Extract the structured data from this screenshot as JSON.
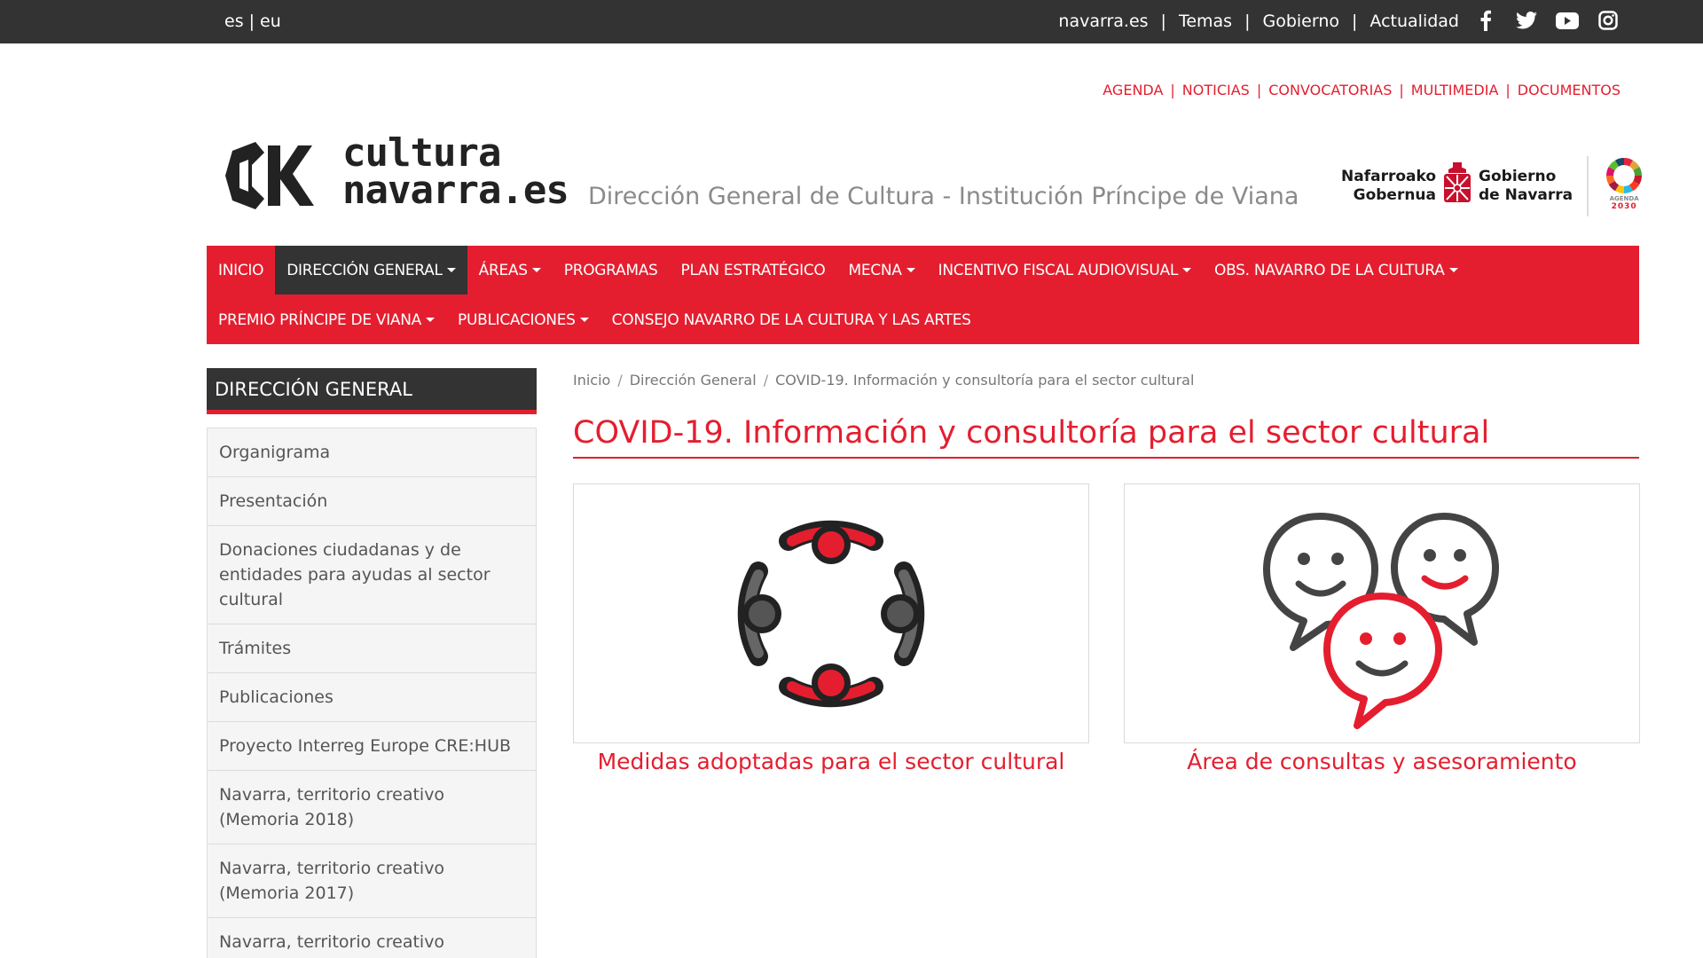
{
  "topbar": {
    "languages": [
      "es",
      "eu"
    ],
    "separator": "|",
    "links": [
      "navarra.es",
      "Temas",
      "Gobierno",
      "Actualidad"
    ],
    "social_icons": [
      "facebook-icon",
      "twitter-icon",
      "youtube-icon",
      "instagram-icon"
    ]
  },
  "sublinks": [
    "AGENDA",
    "NOTICIAS",
    "CONVOCATORIAS",
    "MULTIMEDIA",
    "DOCUMENTOS"
  ],
  "header": {
    "logo_line1": "cultura",
    "logo_line2": "navarra.es",
    "subtitle": "Dirección General de Cultura - Institución Príncipe de Viana",
    "gov_left_1": "Nafarroako",
    "gov_left_2": "Gobernua",
    "gov_right_1": "Gobierno",
    "gov_right_2": "de Navarra",
    "agenda_label_1": "AGENDA",
    "agenda_label_2": "2030"
  },
  "nav": {
    "row1": [
      {
        "label": "INICIO",
        "dropdown": false,
        "active": false
      },
      {
        "label": "DIRECCIÓN GENERAL",
        "dropdown": true,
        "active": true
      },
      {
        "label": "ÁREAS",
        "dropdown": true,
        "active": false
      },
      {
        "label": "PROGRAMAS",
        "dropdown": false,
        "active": false
      },
      {
        "label": "PLAN ESTRATÉGICO",
        "dropdown": false,
        "active": false
      },
      {
        "label": "MECNA",
        "dropdown": true,
        "active": false
      },
      {
        "label": "INCENTIVO FISCAL AUDIOVISUAL",
        "dropdown": true,
        "active": false
      },
      {
        "label": "OBS. NAVARRO DE LA CULTURA",
        "dropdown": true,
        "active": false
      }
    ],
    "row2": [
      {
        "label": "PREMIO PRÍNCIPE DE VIANA",
        "dropdown": true,
        "active": false
      },
      {
        "label": "PUBLICACIONES",
        "dropdown": true,
        "active": false
      },
      {
        "label": "CONSEJO NAVARRO DE LA CULTURA Y LAS ARTES",
        "dropdown": false,
        "active": false
      }
    ]
  },
  "sidebar": {
    "title": "DIRECCIÓN GENERAL",
    "items": [
      "Organigrama",
      "Presentación",
      "Donaciones ciudadanas y de entidades para ayudas al sector cultural",
      "Trámites",
      "Publicaciones",
      "Proyecto Interreg Europe CRE:HUB",
      "Navarra, territorio creativo (Memoria 2018)",
      "Navarra, territorio creativo (Memoria 2017)",
      "Navarra, territorio creativo (Memoria"
    ]
  },
  "breadcrumb": {
    "items": [
      "Inicio",
      "Dirección General",
      "COVID-19. Información y consultoría para el sector cultural"
    ],
    "separator": "/"
  },
  "main": {
    "title": "COVID-19. Información y consultoría para el sector cultural",
    "cards": [
      {
        "label": "Medidas adoptadas para el sector cultural",
        "icon": "people-circle-icon"
      },
      {
        "label": "Área de consultas y asesoramiento",
        "icon": "chat-smileys-icon"
      }
    ]
  },
  "colors": {
    "accent": "#e41e2f",
    "dark": "#333333",
    "sidebar_bg": "#f5f5f5"
  }
}
